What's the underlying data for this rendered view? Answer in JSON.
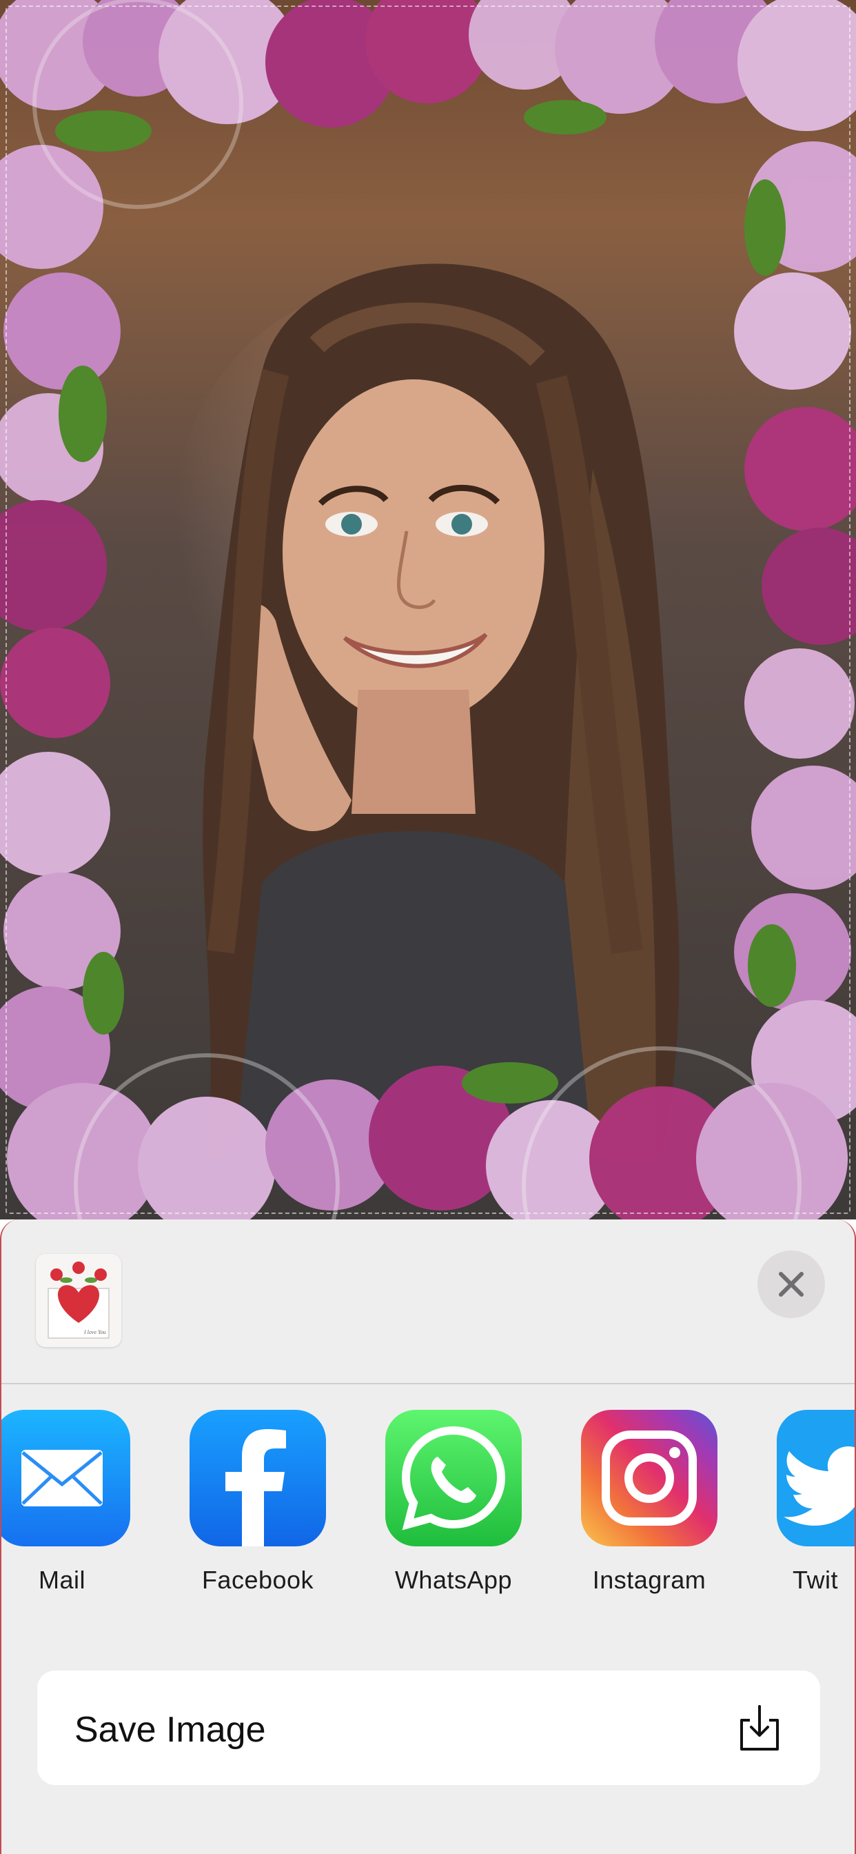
{
  "share_sheet": {
    "apps": [
      {
        "name": "Mail",
        "icon": "mail-icon"
      },
      {
        "name": "Facebook",
        "icon": "facebook-icon"
      },
      {
        "name": "WhatsApp",
        "icon": "whatsapp-icon"
      },
      {
        "name": "Instagram",
        "icon": "instagram-icon"
      },
      {
        "name": "Twit",
        "icon": "twitter-icon"
      }
    ],
    "actions": [
      {
        "label": "Save Image",
        "icon": "save-download-icon"
      }
    ],
    "close_icon": "close-icon",
    "preview_icon": "heart-envelope-thumbnail"
  },
  "thumbnail_text": "I love You",
  "colors": {
    "sheet_background": "#efeeee",
    "card_background": "#ffffff",
    "facebook_blue": "#1877f2",
    "whatsapp_green": "#25d366",
    "mail_blue": "#1a8cff",
    "lilac_pink": "#d7a5d6",
    "lilac_magenta": "#b0357c"
  }
}
